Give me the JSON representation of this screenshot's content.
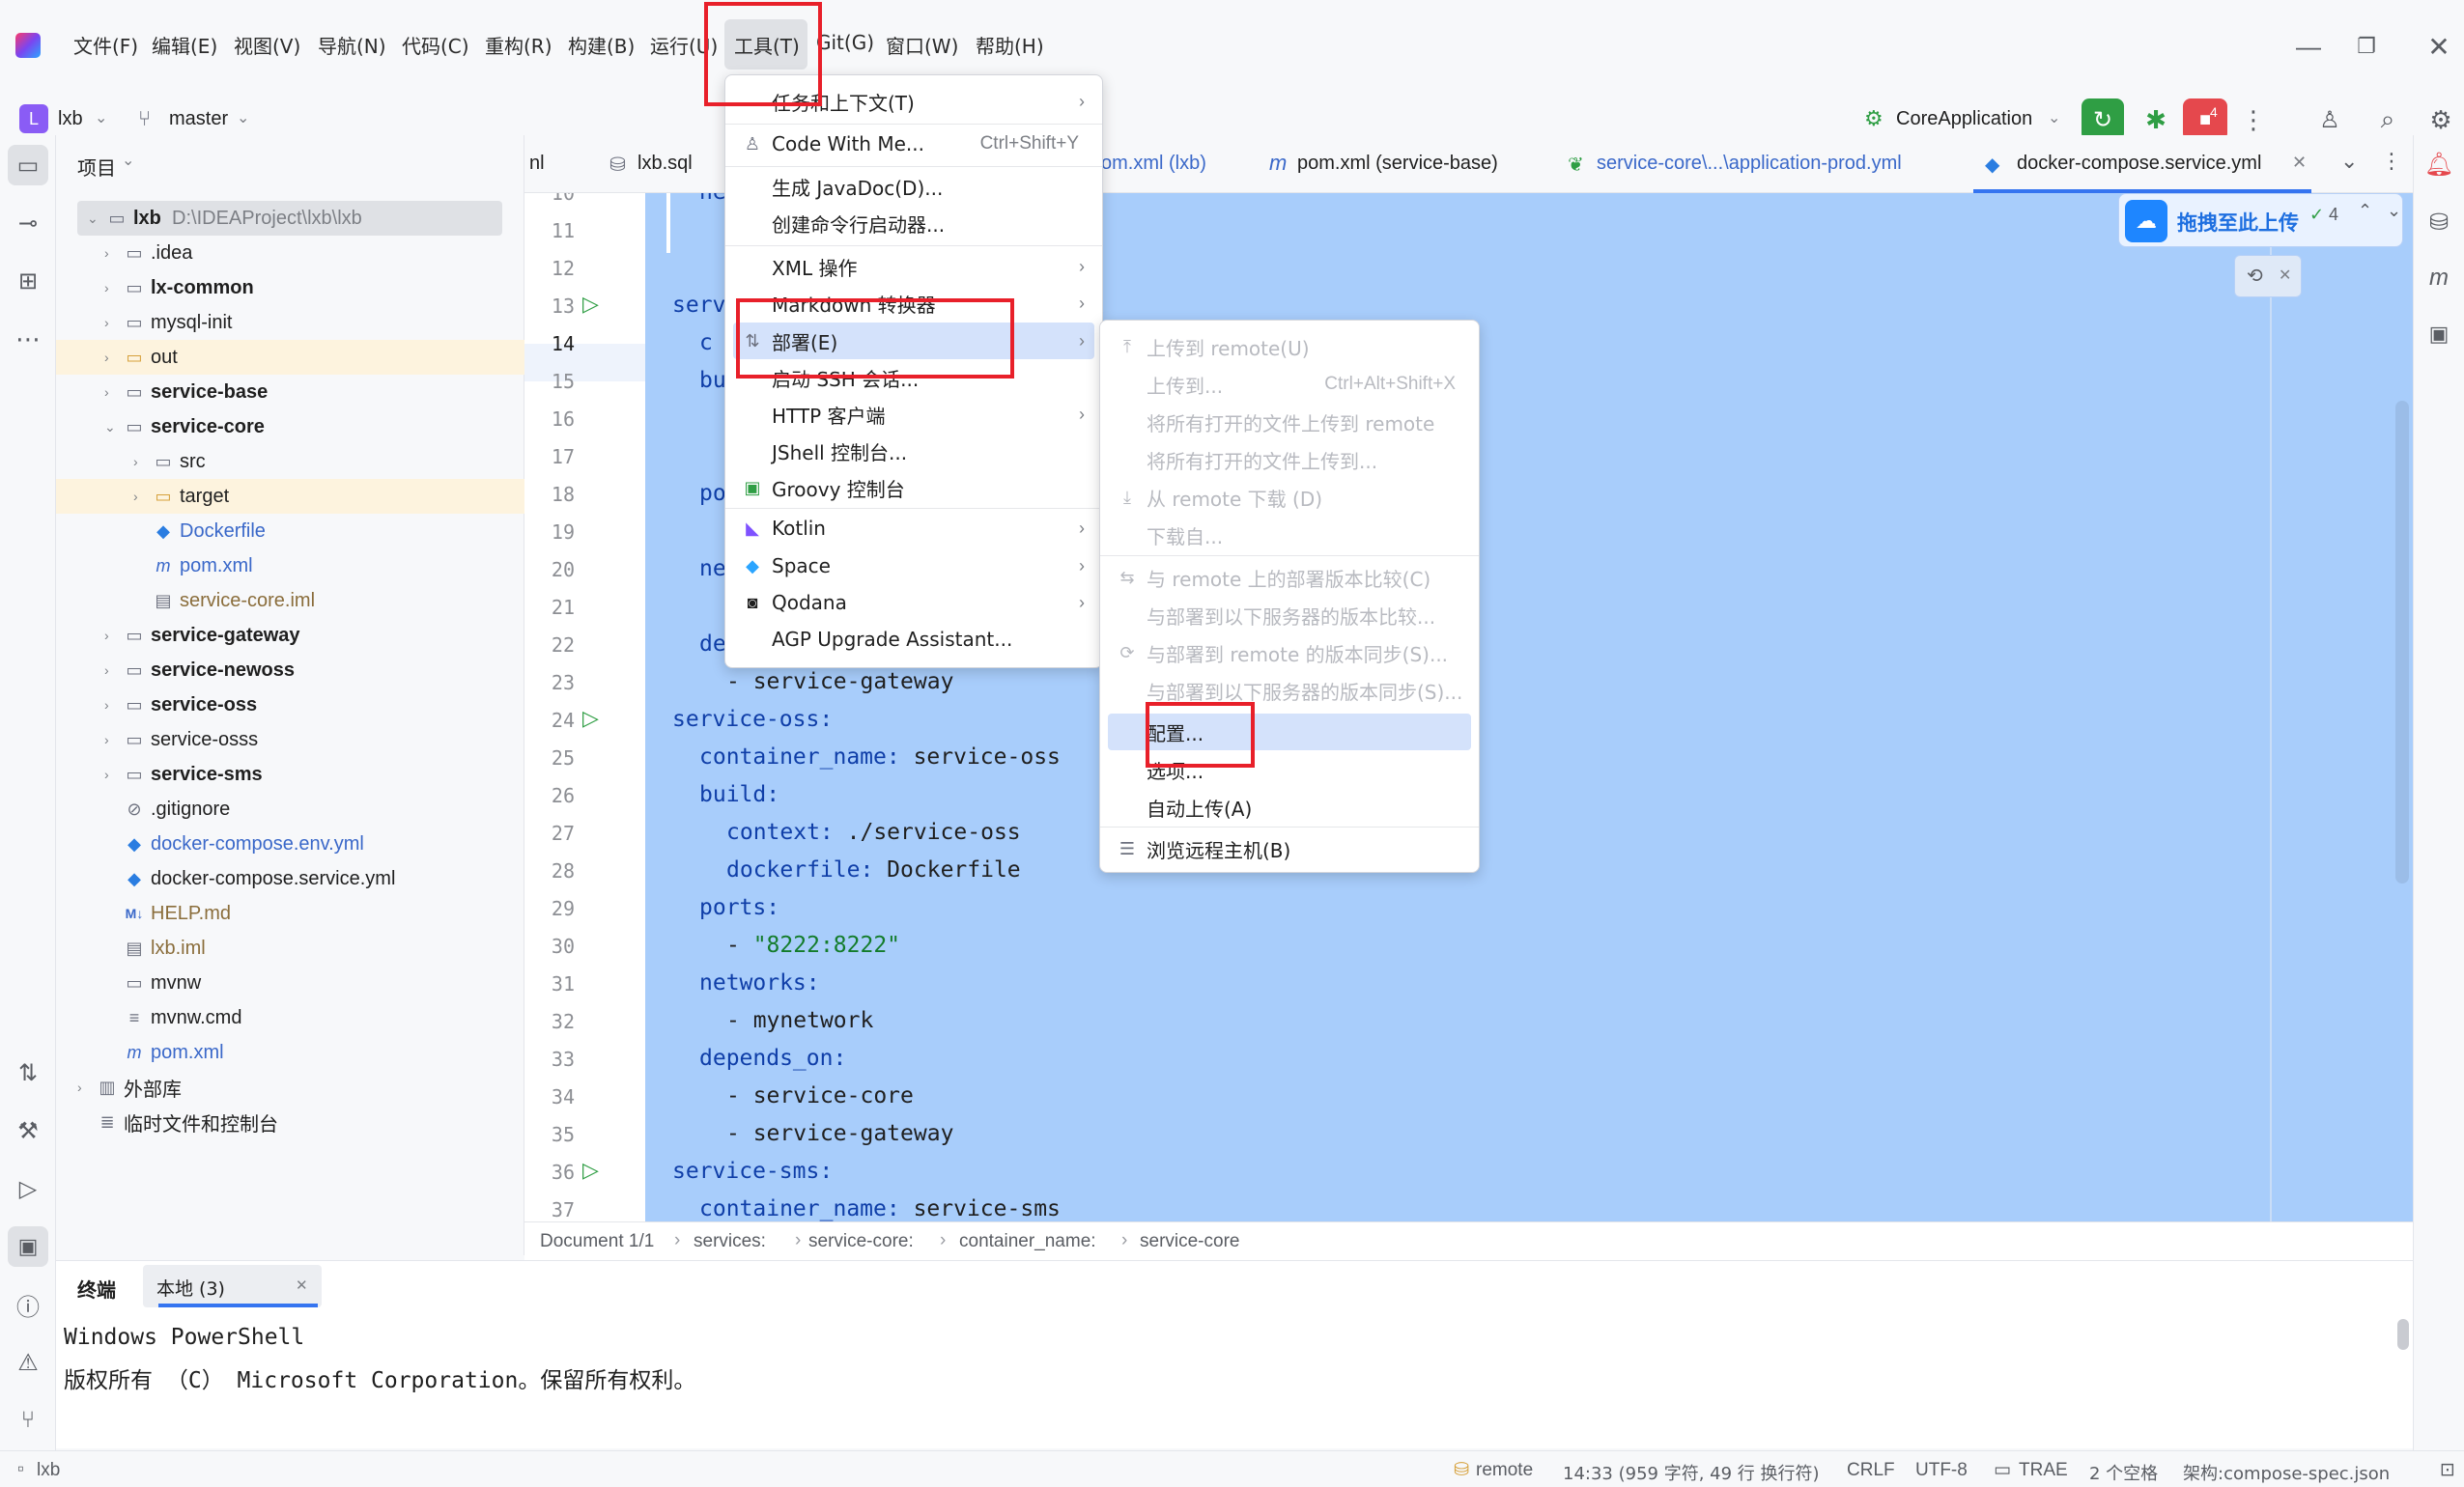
{
  "menubar": [
    "文件(F)",
    "编辑(E)",
    "视图(V)",
    "导航(N)",
    "代码(C)",
    "重构(R)",
    "构建(B)",
    "运行(U)",
    "工具(T)",
    "Git(G)",
    "窗口(W)",
    "帮助(H)"
  ],
  "project": {
    "badge": "L",
    "name": "lxb",
    "branch": "master"
  },
  "run_config": "CoreApplication",
  "badge_count": "4",
  "sidebar_title": "项目",
  "tree": [
    {
      "label": "lxb",
      "extra": "D:\\IDEAProject\\lxb\\lxb"
    },
    {
      "label": ".idea"
    },
    {
      "label": "lx-common"
    },
    {
      "label": "mysql-init"
    },
    {
      "label": "out"
    },
    {
      "label": "service-base"
    },
    {
      "label": "service-core"
    },
    {
      "label": "src"
    },
    {
      "label": "target"
    },
    {
      "label": "Dockerfile"
    },
    {
      "label": "pom.xml"
    },
    {
      "label": "service-core.iml"
    },
    {
      "label": "service-gateway"
    },
    {
      "label": "service-newoss"
    },
    {
      "label": "service-oss"
    },
    {
      "label": "service-osss"
    },
    {
      "label": "service-sms"
    },
    {
      "label": ".gitignore"
    },
    {
      "label": "docker-compose.env.yml"
    },
    {
      "label": "docker-compose.service.yml"
    },
    {
      "label": "HELP.md"
    },
    {
      "label": "lxb.iml"
    },
    {
      "label": "mvnw"
    },
    {
      "label": "mvnw.cmd"
    },
    {
      "label": "pom.xml"
    },
    {
      "label": "外部库"
    },
    {
      "label": "临时文件和控制台"
    }
  ],
  "tabs": [
    "nl",
    "lxb.sql",
    "om.xml (lxb)",
    "pom.xml (service-base)",
    "service-core\\...\\application-prod.yml",
    "docker-compose.service.yml"
  ],
  "upload_banner": "拖拽至此上传",
  "problems_count": "4",
  "line_numbers": [
    "10",
    "11",
    "12",
    "13",
    "14",
    "15",
    "16",
    "17",
    "18",
    "19",
    "20",
    "21",
    "22",
    "23",
    "24",
    "25",
    "26",
    "27",
    "28",
    "29",
    "30",
    "31",
    "32",
    "33",
    "34",
    "35",
    "36",
    "37"
  ],
  "code": {
    "l10": "ne",
    "l13": "serv",
    "l14": "c",
    "l15": "bu",
    "l18": "po",
    "l20": "ne",
    "l22": "de",
    "l23a": "- ",
    "l23b": "service-gateway",
    "l24": "service-oss:",
    "l25a": "container_name:",
    "l25b": " service-oss",
    "l26": "build:",
    "l27a": "context:",
    "l27b": " ./service-oss",
    "l28a": "dockerfile:",
    "l28b": " Dockerfile",
    "l29": "ports:",
    "l30a": "- ",
    "l30b": "\"8222:8222\"",
    "l31": "networks:",
    "l32a": "- ",
    "l32b": "mynetwork",
    "l33": "depends_on:",
    "l34a": "- ",
    "l34b": "service-core",
    "l35a": "- ",
    "l35b": "service-gateway",
    "l36": "service-sms:",
    "l37a": "container_name:",
    "l37b": " service-sms"
  },
  "breadcrumb": [
    "Document 1/1",
    "services:",
    "service-core:",
    "container_name:",
    "service-core"
  ],
  "terminal": {
    "tab_title": "终端",
    "tab_local": "本地 (3)",
    "line1": "Windows PowerShell",
    "line2": "版权所有 （C） Microsoft Corporation。保留所有权利。"
  },
  "tools_menu": [
    {
      "label": "任务和上下文(T)",
      "arrow": true
    },
    {
      "label": "Code With Me...",
      "shortcut": "Ctrl+Shift+Y"
    },
    {
      "label": "生成 JavaDoc(D)..."
    },
    {
      "label": "创建命令行启动器..."
    },
    {
      "label": "XML 操作",
      "arrow": true
    },
    {
      "label": "Markdown 转换器",
      "arrow": true
    },
    {
      "label": "部署(E)",
      "arrow": true
    },
    {
      "label": "启动 SSH 会话..."
    },
    {
      "label": "HTTP 客户端",
      "arrow": true
    },
    {
      "label": "JShell 控制台..."
    },
    {
      "label": "Groovy 控制台"
    },
    {
      "label": "Kotlin",
      "arrow": true
    },
    {
      "label": "Space",
      "arrow": true
    },
    {
      "label": "Qodana",
      "arrow": true
    },
    {
      "label": "AGP Upgrade Assistant..."
    }
  ],
  "deploy_menu": [
    {
      "label": "上传到 remote(U)"
    },
    {
      "label": "上传到...",
      "shortcut": "Ctrl+Alt+Shift+X"
    },
    {
      "label": "将所有打开的文件上传到 remote"
    },
    {
      "label": "将所有打开的文件上传到..."
    },
    {
      "label": "从 remote 下载 (D)"
    },
    {
      "label": "下载自..."
    },
    {
      "label": "与 remote 上的部署版本比较(C)"
    },
    {
      "label": "与部署到以下服务器的版本比较..."
    },
    {
      "label": "与部署到 remote 的版本同步(S)..."
    },
    {
      "label": "与部署到以下服务器的版本同步(S)..."
    },
    {
      "label": "配置..."
    },
    {
      "label": "选项..."
    },
    {
      "label": "自动上传(A)"
    },
    {
      "label": "浏览远程主机(B)"
    }
  ],
  "status": {
    "left": "lxb",
    "remote": "remote",
    "position": "14:33 (959 字符, 49 行 换行符)",
    "line_sep": "CRLF",
    "encoding": "UTF-8",
    "trae": "TRAE",
    "indent": "2 个空格",
    "schema": "架构:compose-spec.json"
  },
  "colors": {
    "accent": "#3574f0",
    "selection": "#a8cdfb",
    "highlight_box": "#e8202a",
    "run_green": "#2f9e44",
    "stop_red": "#e5484d"
  }
}
